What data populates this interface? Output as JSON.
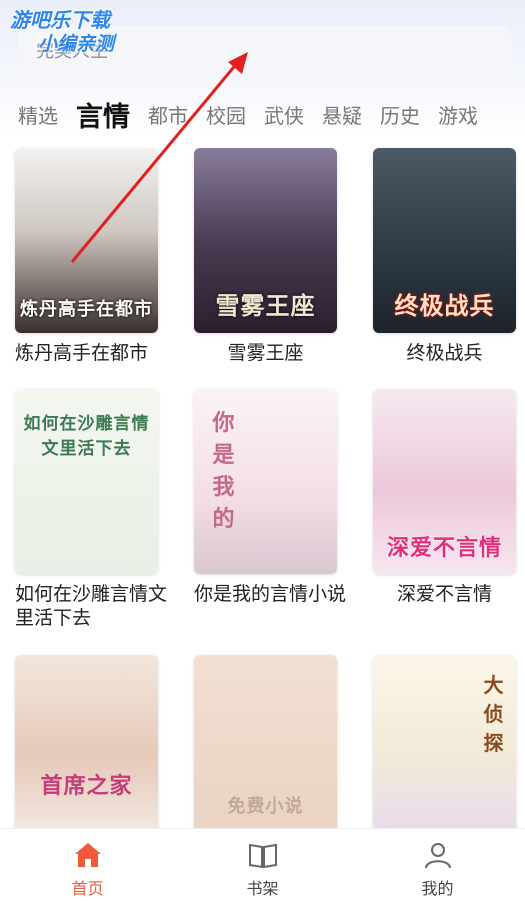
{
  "watermark": {
    "line1": "游吧乐下载",
    "line2": "小编亲测"
  },
  "search": {
    "placeholder": "完美人生"
  },
  "tabs": [
    "精选",
    "言情",
    "都市",
    "校园",
    "武侠",
    "悬疑",
    "历史",
    "游戏"
  ],
  "active_tab": "言情",
  "books": [
    {
      "title": "炼丹高手在都市",
      "cover_text": "炼丹高手在都市"
    },
    {
      "title": "雪雾王座",
      "cover_text": "雪雾王座"
    },
    {
      "title": "终极战兵",
      "cover_text": "终极战兵"
    },
    {
      "title": "如何在沙雕言情文里活下去",
      "cover_text": "如何在沙雕言情文里活下去"
    },
    {
      "title": "你是我的言情小说",
      "cover_text": "你是我的"
    },
    {
      "title": "深爱不言情",
      "cover_text": "深爱不言情"
    },
    {
      "title": "",
      "cover_text": "首席之家"
    },
    {
      "title": "",
      "cover_text": "免费小说"
    },
    {
      "title": "",
      "cover_text": "大侦探"
    }
  ],
  "nav": [
    {
      "label": "首页",
      "icon": "home-icon",
      "active": true
    },
    {
      "label": "书架",
      "icon": "book-icon",
      "active": false
    },
    {
      "label": "我的",
      "icon": "user-icon",
      "active": false
    }
  ],
  "colors": {
    "accent": "#ef5a3c",
    "watermark": "#2f86e8",
    "annotation_arrow": "#e02020"
  }
}
